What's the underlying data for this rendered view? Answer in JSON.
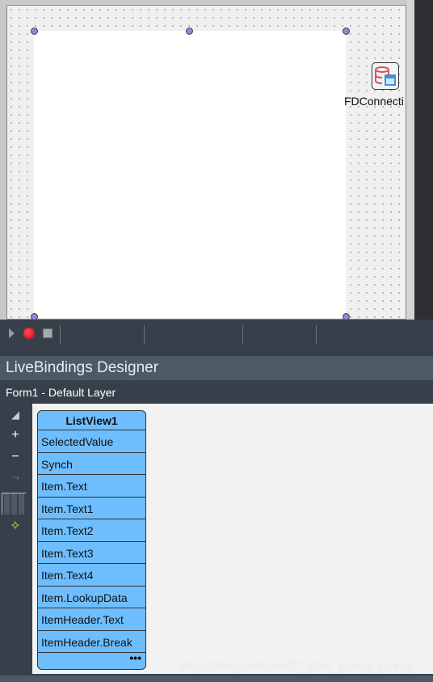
{
  "form_designer": {
    "component_label": "FDConnecti",
    "component_icon": "database-connection-icon"
  },
  "toolbar": {
    "icons": [
      "play-icon",
      "record-icon",
      "stop-icon"
    ]
  },
  "panel": {
    "title": "LiveBindings Designer",
    "layer": "Form1  - Default Layer"
  },
  "left_tools": [
    "arrange-icon",
    "zoom-in-icon",
    "zoom-out-icon",
    "link-icon",
    "grid-icon",
    "wizard-icon"
  ],
  "listview": {
    "title": "ListView1",
    "members": [
      "SelectedValue",
      "Synch",
      "Item.Text",
      "Item.Text1",
      "Item.Text2",
      "Item.Text3",
      "Item.Text4",
      "Item.LookupData",
      "ItemHeader.Text",
      "ItemHeader.Break"
    ],
    "more": "•••",
    "color": "#6ebeff"
  },
  "watermark": "https://blog.csdn.net/IT_xiao_guang_guang"
}
